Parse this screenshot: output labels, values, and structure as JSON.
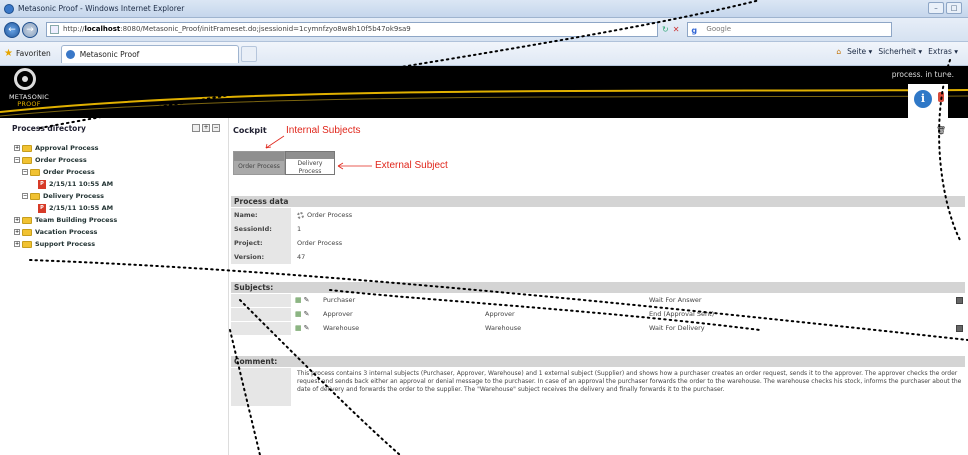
{
  "browser": {
    "window_title": "Metasonic Proof - Windows Internet Explorer",
    "window_controls": [
      "–",
      "□"
    ],
    "url_prefix": "http://",
    "url_host": "localhost",
    "url_rest": ":8080/Metasonic_Proof/initFrameset.do;jsessionid=1cymnfzyo8w8h10f5b47ok9sa9",
    "search_placeholder": "Google",
    "favorites_label": "Favoriten",
    "tab_label": "Metasonic Proof",
    "menu": [
      "Seite ▾",
      "Sicherheit ▾",
      "Extras ▾"
    ]
  },
  "app": {
    "logo_text_1": "METASONIC",
    "logo_text_2": "PROOF",
    "tagline": "process. in tune.",
    "info_label": "i"
  },
  "sidebar": {
    "title": "Process directory",
    "tree": [
      {
        "label": "Approval Process",
        "type": "folder",
        "pm": "+"
      },
      {
        "label": "Order Process",
        "type": "folder",
        "pm": "−"
      },
      {
        "label": "Order Process",
        "type": "folder",
        "pm": "−"
      },
      {
        "label": "2/15/11 10:55 AM",
        "type": "instance"
      },
      {
        "label": "Delivery Process",
        "type": "folder",
        "pm": "−"
      },
      {
        "label": "2/15/11 10:55 AM",
        "type": "instance"
      },
      {
        "label": "Team Building Process",
        "type": "folder",
        "pm": "+"
      },
      {
        "label": "Vacation Process",
        "type": "folder",
        "pm": "+"
      },
      {
        "label": "Support Process",
        "type": "folder",
        "pm": "+"
      }
    ]
  },
  "cockpit": {
    "title": "Cockpit",
    "subject_internal": "Order Process",
    "subject_external_line1": "Delivery",
    "subject_external_line2": "Process"
  },
  "annotations": {
    "internal": "Internal Subjects",
    "external": "External Subject"
  },
  "process_data": {
    "header": "Process data",
    "rows": [
      {
        "key": "Name:",
        "value": "Order Process"
      },
      {
        "key": "SessionId:",
        "value": "1"
      },
      {
        "key": "Project:",
        "value": "Order Process"
      },
      {
        "key": "Version:",
        "value": "47"
      }
    ]
  },
  "subjects": {
    "header": "Subjects:",
    "rows": [
      {
        "name": "Purchaser",
        "role": "",
        "state": "Wait For Answer"
      },
      {
        "name": "Approver",
        "role": "Approver",
        "state": "End (Approval Sent)"
      },
      {
        "name": "Warehouse",
        "role": "Warehouse",
        "state": "Wait For Delivery"
      }
    ]
  },
  "comment": {
    "header": "Comment:",
    "text": "This process contains 3 internal subjects (Purchaser, Approver, Warehouse) and 1 external subject (Supplier) and shows how a purchaser creates an order request, sends it to the approver. The approver checks the order request and sends back either an approval or denial message to the purchaser. In case of an approval the purchaser forwards the order to the warehouse. The warehouse checks his stock, informs the purchaser about the date of delivery and forwards the order to the supplier. The \"Warehouse\" subject receives the delivery and finally forwards it to the purchaser."
  },
  "colors": {
    "annotation": "#e0261b",
    "header_bg": "#000000",
    "section_bg": "#d4d4d4"
  }
}
